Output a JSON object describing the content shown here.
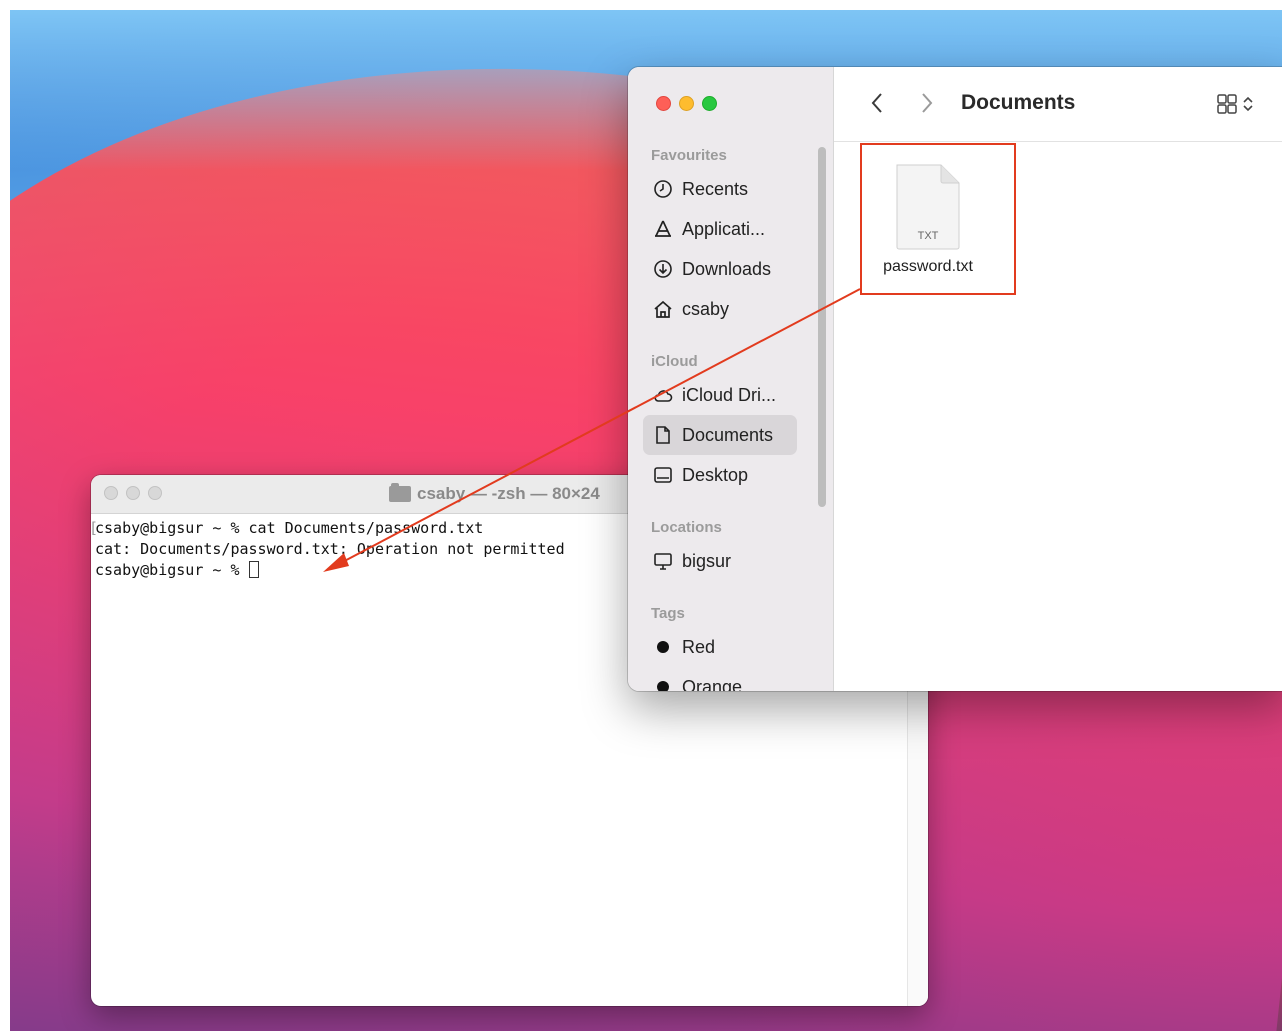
{
  "terminal": {
    "title": "csaby — -zsh — 80×24",
    "lines": [
      "csaby@bigsur ~ % cat Documents/password.txt",
      "cat: Documents/password.txt: Operation not permitted",
      "csaby@bigsur ~ % "
    ]
  },
  "finder": {
    "title": "Documents",
    "sidebar": {
      "favourites_label": "Favourites",
      "favourites": [
        {
          "label": "Recents",
          "icon": "clock-icon"
        },
        {
          "label": "Applicati...",
          "icon": "applications-icon"
        },
        {
          "label": "Downloads",
          "icon": "download-icon"
        },
        {
          "label": "csaby",
          "icon": "home-icon"
        }
      ],
      "icloud_label": "iCloud",
      "icloud": [
        {
          "label": "iCloud Dri...",
          "icon": "cloud-icon"
        },
        {
          "label": "Documents",
          "icon": "document-icon",
          "selected": true
        },
        {
          "label": "Desktop",
          "icon": "desktop-icon"
        }
      ],
      "locations_label": "Locations",
      "locations": [
        {
          "label": "bigsur",
          "icon": "computer-icon"
        }
      ],
      "tags_label": "Tags",
      "tags": [
        {
          "label": "Red",
          "color": "#111111"
        },
        {
          "label": "Orange",
          "color": "#111111"
        }
      ]
    },
    "files": [
      {
        "name": "password.txt",
        "type_label": "TXT"
      }
    ]
  },
  "annotation": {
    "highlight_color": "#e23b1e"
  }
}
